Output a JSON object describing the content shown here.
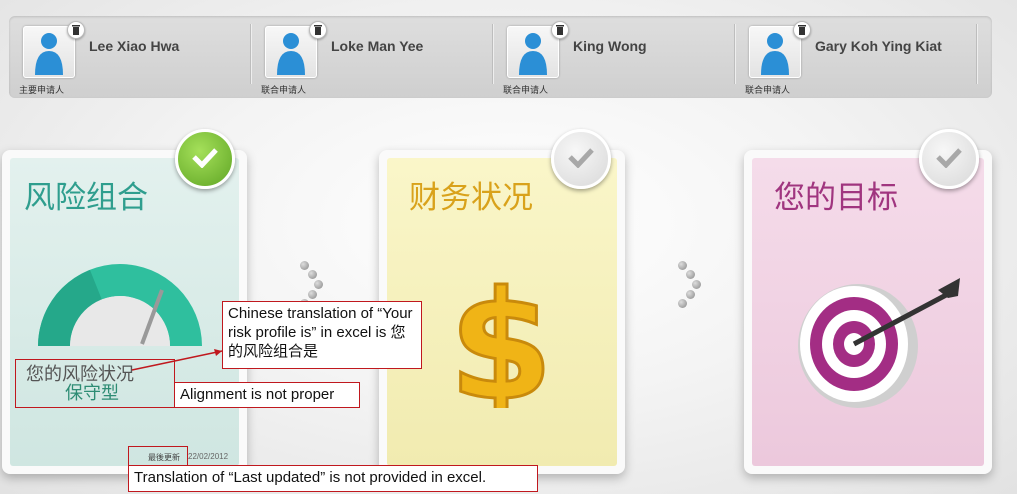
{
  "applicants": [
    {
      "name": "Lee Xiao Hwa",
      "role": "主要申请人"
    },
    {
      "name": "Loke Man Yee",
      "role": "联合申请人"
    },
    {
      "name": "King Wong",
      "role": "联合申请人"
    },
    {
      "name": "Gary Koh Ying Kiat",
      "role": "联合申请人"
    }
  ],
  "cards": {
    "risk": {
      "title": "风险组合",
      "risk_label": "您的风险状况",
      "risk_value": "保守型",
      "last_updated_label": "最後更新",
      "last_updated_date": "22/02/2012",
      "completed": true
    },
    "finance": {
      "title": "财务状况",
      "completed": false
    },
    "goals": {
      "title": "您的目标",
      "completed": false
    }
  },
  "annotations": {
    "translation": "Chinese translation of “Your risk profile is” in excel is 您的风险组合是",
    "alignment": "Alignment is not proper",
    "last_updated": "Translation of “Last updated” is not provided in excel."
  },
  "colors": {
    "risk_title": "#2f9e8e",
    "finance_title": "#d9a21b",
    "goals_title": "#a0357f",
    "check_done": "#7cc23a",
    "annotation_red": "#c0181e"
  },
  "icons": [
    "user-icon",
    "trash-icon",
    "check-icon",
    "gauge-icon",
    "dollar-icon",
    "target-icon"
  ]
}
